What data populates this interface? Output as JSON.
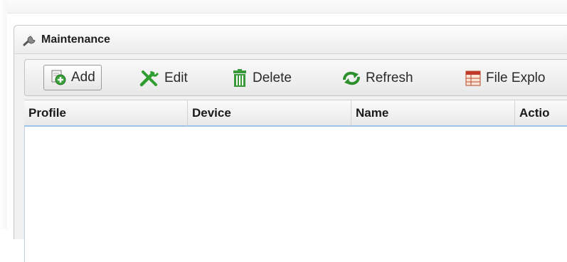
{
  "panel": {
    "title": "Maintenance"
  },
  "toolbar": {
    "add_label": "Add",
    "edit_label": "Edit",
    "delete_label": "Delete",
    "refresh_label": "Refresh",
    "file_explorer_label": "File Explo"
  },
  "table": {
    "columns": [
      "Profile",
      "Device",
      "Name",
      "Actio"
    ],
    "rows": []
  },
  "colors": {
    "header_underline": "#9cc3ea",
    "add_icon_green": "#3aa23a",
    "edit_icon_green": "#2e9e2e",
    "delete_icon_green": "#3a9a3a",
    "refresh_icon_green": "#2c8f2c",
    "file_explorer_icon": "#c0392b"
  },
  "icons": {
    "title": "wrench-icon",
    "add": "add-icon",
    "edit": "tools-icon",
    "delete": "trash-icon",
    "refresh": "refresh-icon",
    "file_explorer": "file-explorer-icon"
  }
}
